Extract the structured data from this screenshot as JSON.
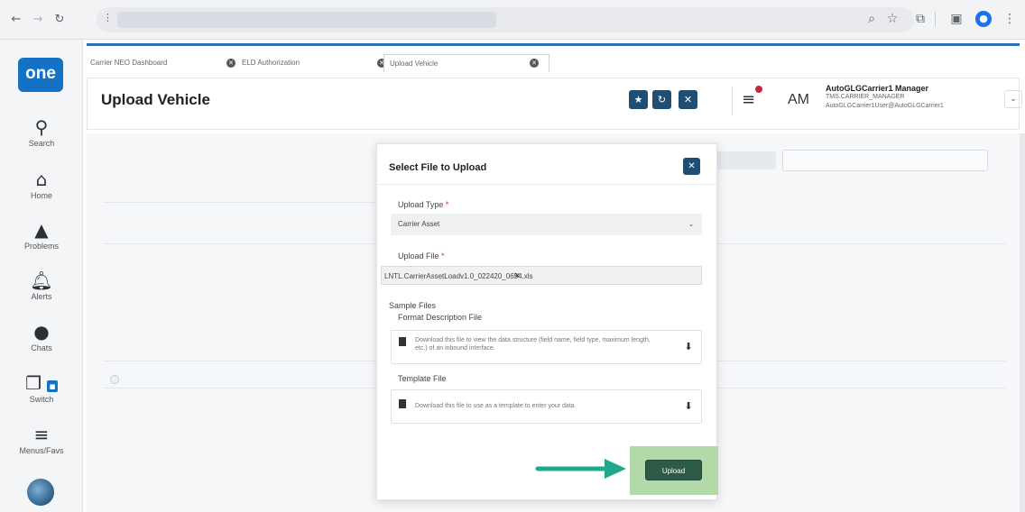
{
  "tabs": [
    {
      "label": "Carrier NEO Dashboard"
    },
    {
      "label": "ELD Authorization"
    },
    {
      "label": "Upload Vehicle"
    }
  ],
  "rail": {
    "logo": "one",
    "items": [
      {
        "label": "Search"
      },
      {
        "label": "Home"
      },
      {
        "label": "Problems"
      },
      {
        "label": "Alerts"
      },
      {
        "label": "Chats"
      },
      {
        "label": "Switch"
      },
      {
        "label": "Menus/Favs"
      }
    ]
  },
  "header": {
    "title": "Upload Vehicle",
    "user_initials": "AM",
    "user_name": "AutoGLGCarrier1 Manager",
    "user_role": "TMS.CARRIER_MANAGER",
    "user_email": "AutoGLGCarrier1User@AutoGLGCarrier1"
  },
  "modal": {
    "title": "Select File to Upload",
    "upload_type_label": "Upload Type",
    "upload_type_value": "Carrier Asset",
    "upload_file_label": "Upload File",
    "upload_file_value": "LNTL.CarrierAssetLoadv1.0_022420_0654.xls",
    "required_mark": "*",
    "sample_files_label": "Sample Files",
    "format_desc_label": "Format Description File",
    "format_desc_text": "Download this file to view the data structure (field name, field type, maximum length, etc.) of an inbound interface.",
    "template_label": "Template File",
    "template_text": "Download this file to use as a template to enter your data",
    "upload_button": "Upload"
  },
  "colors": {
    "accent": "#1f4e75",
    "brand_blue": "#1472c4",
    "upload_button": "#2d5a45",
    "highlight": "#b3d9a8",
    "arrow": "#1fa88a",
    "notification": "#c6273a"
  }
}
